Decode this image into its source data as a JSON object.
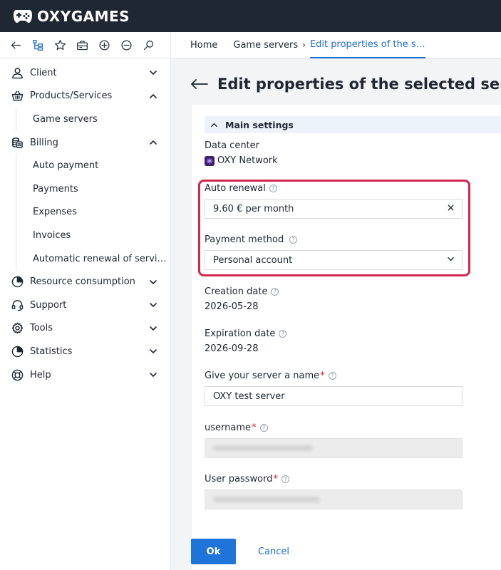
{
  "brand": {
    "name": "OXYGAMES"
  },
  "toolbar": {
    "tools": [
      "back-icon",
      "tree-icon",
      "star-icon",
      "briefcase-icon",
      "plus-circle-icon",
      "minus-circle-icon",
      "search-icon"
    ]
  },
  "breadcrumb": {
    "home": "Home",
    "game_servers": "Game servers",
    "current": "Edit properties of the s…"
  },
  "sidebar": {
    "client": "Client",
    "products": "Products/Services",
    "products_sub": [
      "Game servers"
    ],
    "billing": "Billing",
    "billing_sub": [
      "Auto payment",
      "Payments",
      "Expenses",
      "Invoices",
      "Automatic renewal of servi…"
    ],
    "resource": "Resource consumption",
    "support": "Support",
    "tools": "Tools",
    "statistics": "Statistics",
    "help": "Help"
  },
  "page": {
    "title": "Edit properties of the selected service -"
  },
  "form": {
    "section_title": "Main settings",
    "data_center_label": "Data center",
    "data_center_value": "OXY Network",
    "auto_renewal_label": "Auto renewal",
    "auto_renewal_value": "9.60 € per month",
    "payment_method_label": "Payment method",
    "payment_method_value": "Personal account",
    "creation_date_label": "Creation date",
    "creation_date_value": "2026-05-28",
    "expiration_date_label": "Expiration date",
    "expiration_date_value": "2026-09-28",
    "server_name_label": "Give your server a name",
    "server_name_value": "OXY test server",
    "username_label": "username",
    "password_label": "User password",
    "required_mark": "*",
    "help_mark": "?"
  },
  "actions": {
    "ok": "Ok",
    "cancel": "Cancel"
  },
  "colors": {
    "brand_bar": "#1f2733",
    "accent": "#1e74d8",
    "highlight": "#d1264e",
    "required": "#d2222d"
  }
}
